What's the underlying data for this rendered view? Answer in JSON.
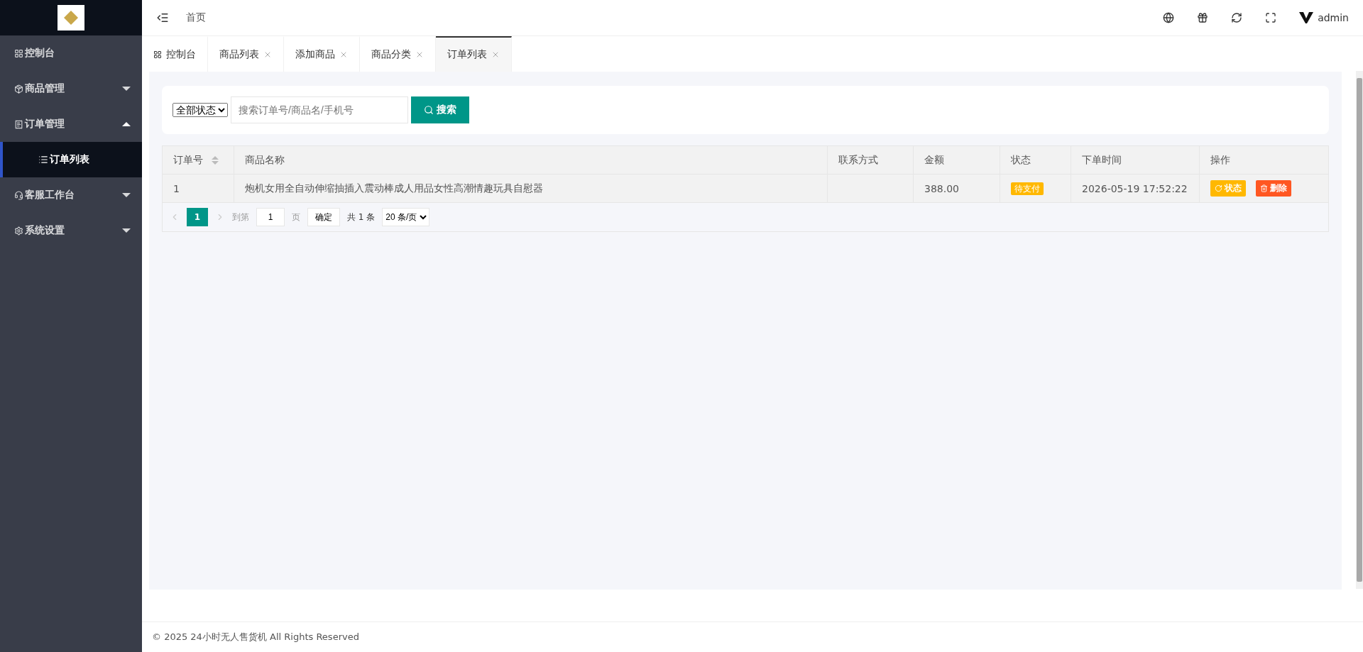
{
  "sidebar": {
    "items": [
      {
        "label": "控制台",
        "selected": false
      },
      {
        "label": "商品管理",
        "expanded": false,
        "selected": false
      },
      {
        "label": "订单管理",
        "expanded": true,
        "selected": false,
        "children": [
          {
            "label": "订单列表",
            "selected": true
          }
        ]
      },
      {
        "label": "客服工作台",
        "expanded": false,
        "selected": false
      },
      {
        "label": "系统设置",
        "expanded": false,
        "selected": false
      }
    ]
  },
  "header": {
    "breadcrumb": "首页",
    "user": "admin"
  },
  "tabs": [
    {
      "label": "控制台",
      "closable": false,
      "selected": false
    },
    {
      "label": "商品列表",
      "closable": true,
      "selected": false
    },
    {
      "label": "添加商品",
      "closable": true,
      "selected": false
    },
    {
      "label": "商品分类",
      "closable": true,
      "selected": false
    },
    {
      "label": "订单列表",
      "closable": true,
      "selected": true
    }
  ],
  "filter": {
    "status": "全部状态",
    "placeholder": "搜索订单号/商品名/手机号",
    "button": "搜索"
  },
  "table": {
    "columns": [
      "订单号",
      "商品名称",
      "联系方式",
      "金额",
      "状态",
      "下单时间",
      "操作"
    ],
    "rows": [
      {
        "id": "1",
        "name": "炮机女用全自动伸缩抽插入震动棒成人用品女性高潮情趣玩具自慰器",
        "amount": "388.00",
        "status": "待支付",
        "time": "2026-05-19 17:52:22",
        "actions": [
          "状态",
          "删除"
        ]
      }
    ]
  },
  "pagination": {
    "page": "1",
    "goto_label": "到第",
    "goto_value": "1",
    "page_unit": "页",
    "confirm": "确定",
    "total": "共 1 条",
    "page_size": "20 条/页"
  },
  "footer": "© 2025 24小时无人售货机 All Rights Reserved"
}
